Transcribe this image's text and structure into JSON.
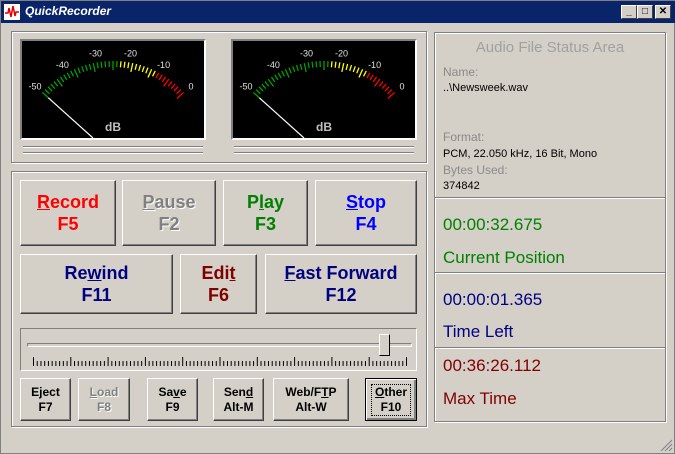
{
  "title": "QuickRecorder",
  "window_controls": {
    "minimize": "_",
    "maximize": "□",
    "close": "✕"
  },
  "meters": {
    "labels": [
      "-50",
      "-40",
      "-30",
      "-20",
      "-10",
      "0"
    ],
    "unit": "dB",
    "level_fraction": 0
  },
  "buttons": {
    "record": {
      "label": "Record",
      "key": "F5",
      "mn": "R",
      "rest": "ecord",
      "color": "#ff0000"
    },
    "pause": {
      "label": "Pause",
      "key": "F2",
      "mn": "P",
      "rest": "ause"
    },
    "play": {
      "label": "Play",
      "key": "F3",
      "pre": "P",
      "mn": "l",
      "rest": "ay",
      "color": "#008000"
    },
    "stop": {
      "label": "Stop",
      "key": "F4",
      "mn": "S",
      "rest": "top",
      "color": "#0000ff"
    },
    "rewind": {
      "label": "Rewind",
      "key": "F11",
      "pre": "Re",
      "mn": "w",
      "rest": "ind",
      "color": "#000080"
    },
    "edit": {
      "label": "Edit",
      "key": "F6",
      "pre": "Edi",
      "mn": "t",
      "rest": "",
      "color": "#800000"
    },
    "fastforward": {
      "label": "Fast Forward",
      "key": "F12",
      "mn": "F",
      "rest": "ast Forward",
      "color": "#000080"
    },
    "eject": {
      "label": "Eject",
      "key": "F7"
    },
    "load": {
      "label": "Load",
      "key": "F8",
      "mn": "L",
      "rest": "oad"
    },
    "save": {
      "label": "Save",
      "key": "F9",
      "pre": "Sa",
      "mn": "v",
      "rest": "e"
    },
    "send": {
      "label": "Send",
      "key": "Alt-M",
      "pre": "Sen",
      "mn": "d",
      "rest": ""
    },
    "web": {
      "label": "Web/FTP",
      "key": "Alt-W",
      "pre": "Web/F",
      "mn": "T",
      "rest": "P"
    },
    "other": {
      "label": "Other",
      "key": "F10",
      "mn": "O",
      "rest": "ther"
    }
  },
  "position_slider": {
    "value_fraction": 0.94
  },
  "status": {
    "heading": "Audio File Status Area",
    "name_label": "Name:",
    "name_value": "..\\Newsweek.wav",
    "format_label": "Format:",
    "format_value": "PCM, 22.050 kHz, 16 Bit, Mono",
    "bytes_label": "Bytes Used:",
    "bytes_value": "374842",
    "current_position": {
      "time": "00:00:32.675",
      "label": "Current Position",
      "color": "#008000"
    },
    "time_left": {
      "time": "00:00:01.365",
      "label": "Time Left",
      "color": "#000080"
    },
    "max_time": {
      "time": "00:36:26.112",
      "label": "Max Time",
      "color": "#800000"
    }
  }
}
